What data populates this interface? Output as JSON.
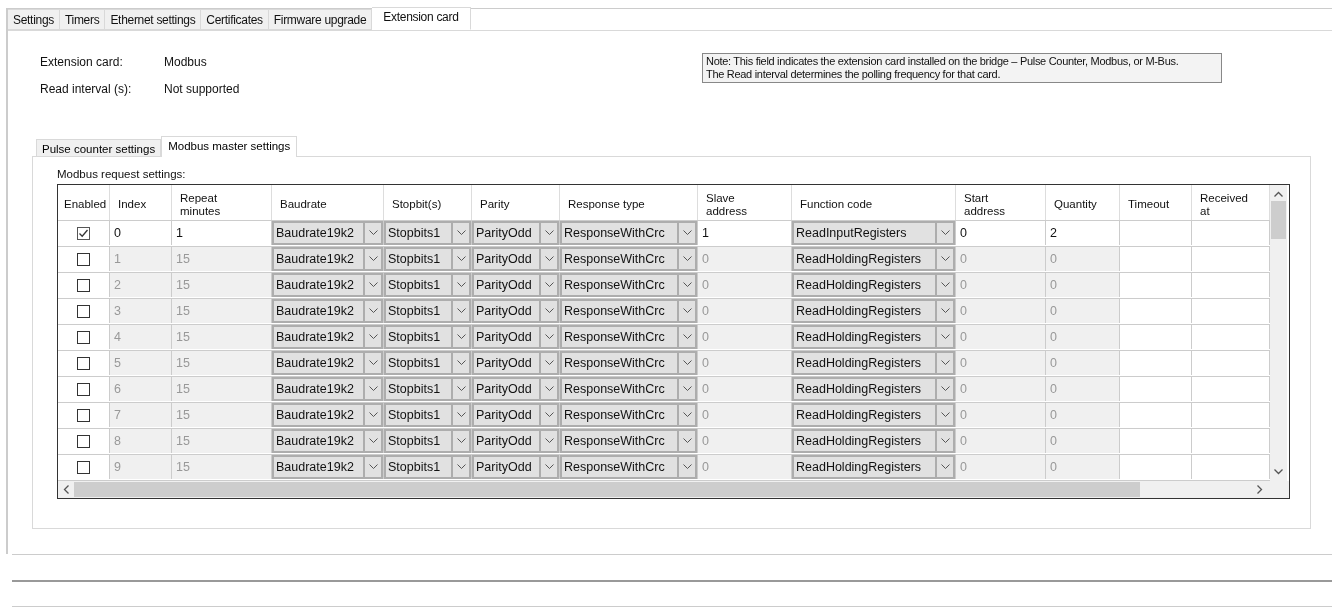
{
  "tabs": [
    {
      "label": "Settings",
      "selected": false
    },
    {
      "label": "Timers",
      "selected": false
    },
    {
      "label": "Ethernet settings",
      "selected": false
    },
    {
      "label": "Certificates",
      "selected": false
    },
    {
      "label": "Firmware upgrade",
      "selected": false
    },
    {
      "label": "Extension card",
      "selected": true
    }
  ],
  "fields": [
    {
      "label": "Extension card:",
      "value": "Modbus"
    },
    {
      "label": "Read interval (s):",
      "value": "Not supported"
    }
  ],
  "note": [
    "Note: This field indicates the extension card installed on the bridge – Pulse Counter, Modbus, or M-Bus.",
    "The Read interval determines the polling frequency for that card."
  ],
  "subtabs": [
    {
      "label": "Pulse counter settings",
      "selected": false
    },
    {
      "label": "Modbus master settings",
      "selected": true
    }
  ],
  "group_label": "Modbus request settings:",
  "table": {
    "columns": [
      "Enabled",
      "Index",
      "Repeat minutes",
      "Baudrate",
      "Stopbit(s)",
      "Parity",
      "Response type",
      "Slave address",
      "Function code",
      "Start address",
      "Quantity",
      "Timeout",
      "Received at"
    ],
    "rows": [
      {
        "enabled": true,
        "index": "0",
        "repeat": "1",
        "baudrate": "Baudrate19k2",
        "stopbits": "Stopbits1",
        "parity": "ParityOdd",
        "response": "ResponseWithCrc",
        "slave": "1",
        "function": "ReadInputRegisters",
        "start": "0",
        "quantity": "2"
      },
      {
        "enabled": false,
        "index": "1",
        "repeat": "15",
        "baudrate": "Baudrate19k2",
        "stopbits": "Stopbits1",
        "parity": "ParityOdd",
        "response": "ResponseWithCrc",
        "slave": "0",
        "function": "ReadHoldingRegisters",
        "start": "0",
        "quantity": "0"
      },
      {
        "enabled": false,
        "index": "2",
        "repeat": "15",
        "baudrate": "Baudrate19k2",
        "stopbits": "Stopbits1",
        "parity": "ParityOdd",
        "response": "ResponseWithCrc",
        "slave": "0",
        "function": "ReadHoldingRegisters",
        "start": "0",
        "quantity": "0"
      },
      {
        "enabled": false,
        "index": "3",
        "repeat": "15",
        "baudrate": "Baudrate19k2",
        "stopbits": "Stopbits1",
        "parity": "ParityOdd",
        "response": "ResponseWithCrc",
        "slave": "0",
        "function": "ReadHoldingRegisters",
        "start": "0",
        "quantity": "0"
      },
      {
        "enabled": false,
        "index": "4",
        "repeat": "15",
        "baudrate": "Baudrate19k2",
        "stopbits": "Stopbits1",
        "parity": "ParityOdd",
        "response": "ResponseWithCrc",
        "slave": "0",
        "function": "ReadHoldingRegisters",
        "start": "0",
        "quantity": "0"
      },
      {
        "enabled": false,
        "index": "5",
        "repeat": "15",
        "baudrate": "Baudrate19k2",
        "stopbits": "Stopbits1",
        "parity": "ParityOdd",
        "response": "ResponseWithCrc",
        "slave": "0",
        "function": "ReadHoldingRegisters",
        "start": "0",
        "quantity": "0"
      },
      {
        "enabled": false,
        "index": "6",
        "repeat": "15",
        "baudrate": "Baudrate19k2",
        "stopbits": "Stopbits1",
        "parity": "ParityOdd",
        "response": "ResponseWithCrc",
        "slave": "0",
        "function": "ReadHoldingRegisters",
        "start": "0",
        "quantity": "0"
      },
      {
        "enabled": false,
        "index": "7",
        "repeat": "15",
        "baudrate": "Baudrate19k2",
        "stopbits": "Stopbits1",
        "parity": "ParityOdd",
        "response": "ResponseWithCrc",
        "slave": "0",
        "function": "ReadHoldingRegisters",
        "start": "0",
        "quantity": "0"
      },
      {
        "enabled": false,
        "index": "8",
        "repeat": "15",
        "baudrate": "Baudrate19k2",
        "stopbits": "Stopbits1",
        "parity": "ParityOdd",
        "response": "ResponseWithCrc",
        "slave": "0",
        "function": "ReadHoldingRegisters",
        "start": "0",
        "quantity": "0"
      },
      {
        "enabled": false,
        "index": "9",
        "repeat": "15",
        "baudrate": "Baudrate19k2",
        "stopbits": "Stopbits1",
        "parity": "ParityOdd",
        "response": "ResponseWithCrc",
        "slave": "0",
        "function": "ReadHoldingRegisters",
        "start": "0",
        "quantity": "0"
      }
    ]
  }
}
